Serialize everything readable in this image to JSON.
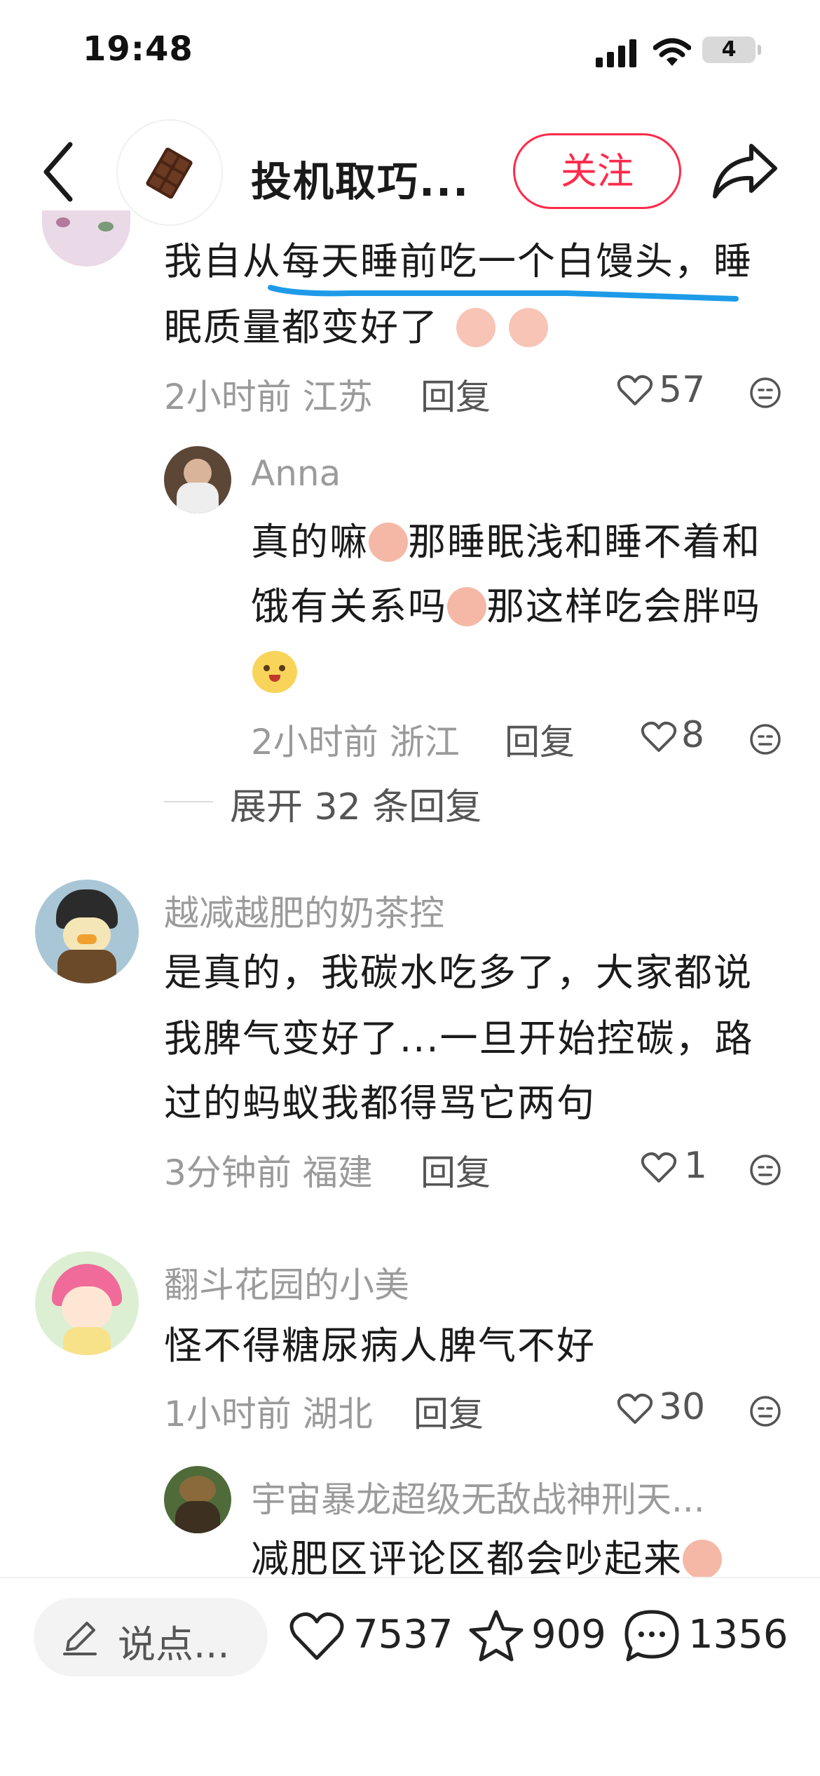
{
  "status": {
    "time": "19:48",
    "battery": "4"
  },
  "header": {
    "title": "投机取巧...",
    "follow_label": "关注"
  },
  "comments": [
    {
      "line1": "我自从每天睡前吃一个白馒头，睡",
      "line2": "眠质量都变好了",
      "time": "2小时前",
      "location": "江苏",
      "reply_label": "回复",
      "likes": "57",
      "replies": [
        {
          "username": "Anna",
          "line1_a": "真的嘛",
          "line1_b": "那睡眠浅和睡不着和",
          "line2_a": "饿有关系吗",
          "line2_b": "那这样吃会胖吗",
          "time": "2小时前",
          "location": "浙江",
          "reply_label": "回复",
          "likes": "8"
        }
      ],
      "expand_label": "展开 32 条回复"
    },
    {
      "username": "越减越肥的奶茶控",
      "line1": "是真的，我碳水吃多了，大家都说",
      "line2": "我脾气变好了...一旦开始控碳，路",
      "line3": "过的蚂蚁我都得骂它两句",
      "time": "3分钟前",
      "location": "福建",
      "reply_label": "回复",
      "likes": "1"
    },
    {
      "username": "翻斗花园的小美",
      "line1": "怪不得糖尿病人脾气不好",
      "time": "1小时前",
      "location": "湖北",
      "reply_label": "回复",
      "likes": "30",
      "replies": [
        {
          "username": "宇宙暴龙超级无敌战神刑天...",
          "line1": "减肥区评论区都会吵起来"
        }
      ]
    }
  ],
  "bottom_bar": {
    "say_placeholder": "说点...",
    "likes": "7537",
    "favorites": "909",
    "comments": "1356"
  }
}
